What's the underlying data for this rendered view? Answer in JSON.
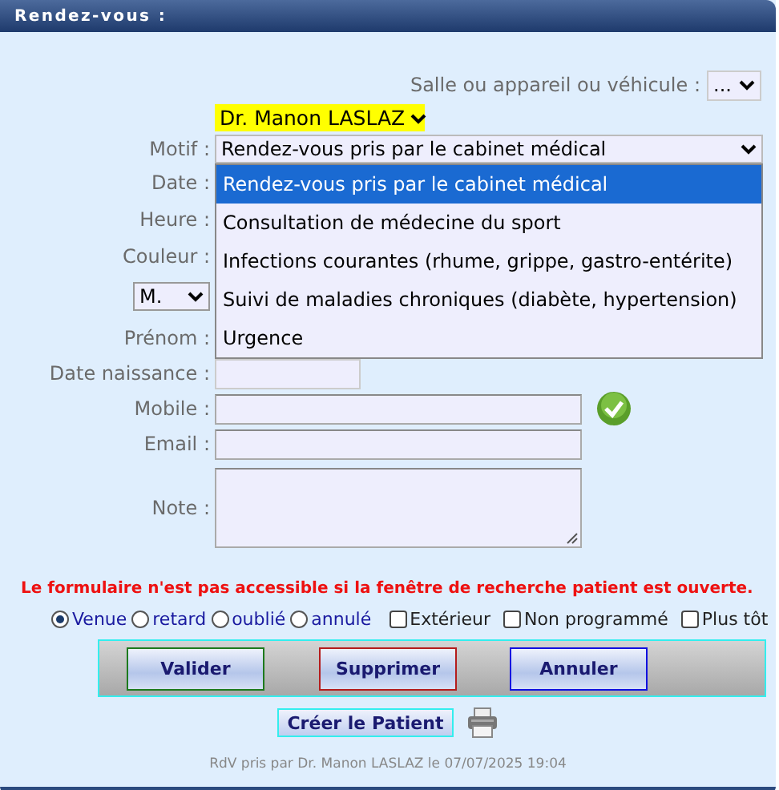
{
  "window": {
    "title": "Rendez-vous :"
  },
  "vehicle": {
    "label": "Salle ou appareil ou véhicule :",
    "value": "..."
  },
  "practitioner": {
    "value": "Dr. Manon LASLAZ"
  },
  "motif": {
    "label": "Motif :",
    "value": "Rendez-vous pris par le cabinet médical",
    "expanded": true,
    "options": [
      {
        "label": "Rendez-vous pris par le cabinet médical",
        "selected": true
      },
      {
        "label": "Consultation de médecine du sport",
        "selected": false
      },
      {
        "label": "Infections courantes (rhume, grippe, gastro-entérite)",
        "selected": false
      },
      {
        "label": "Suivi de maladies chroniques (diabète, hypertension)",
        "selected": false
      },
      {
        "label": "Urgence",
        "selected": false
      }
    ]
  },
  "fields": [
    {
      "kind": "covered",
      "label": "Date :"
    },
    {
      "kind": "covered",
      "label": "Heure :"
    },
    {
      "kind": "covered",
      "label": "Couleur :"
    },
    {
      "kind": "civility",
      "value": "M."
    },
    {
      "kind": "covered",
      "label": "Prénom :"
    },
    {
      "kind": "short",
      "label": "Date naissance :"
    },
    {
      "kind": "text",
      "label": "Mobile :",
      "verified": true
    },
    {
      "kind": "text",
      "label": "Email :"
    },
    {
      "kind": "textarea",
      "label": "Note :"
    }
  ],
  "warning": "Le formulaire n'est pas accessible si la fenêtre de recherche patient est ouverte.",
  "statuses": [
    {
      "label": "Venue",
      "selected": true
    },
    {
      "label": "retard",
      "selected": false
    },
    {
      "label": "oublié",
      "selected": false
    },
    {
      "label": "annulé",
      "selected": false
    }
  ],
  "options": [
    {
      "label": "Extérieur",
      "checked": false
    },
    {
      "label": "Non programmé",
      "checked": false
    },
    {
      "label": "Plus tôt",
      "checked": false
    }
  ],
  "buttons": [
    {
      "label": "Valider",
      "kind": "validate"
    },
    {
      "label": "Supprimer",
      "kind": "delete"
    },
    {
      "label": "Annuler",
      "kind": "cancel"
    }
  ],
  "create_button": "Créer le Patient",
  "footer": "RdV pris par Dr. Manon LASLAZ le 07/07/2025 19:04"
}
